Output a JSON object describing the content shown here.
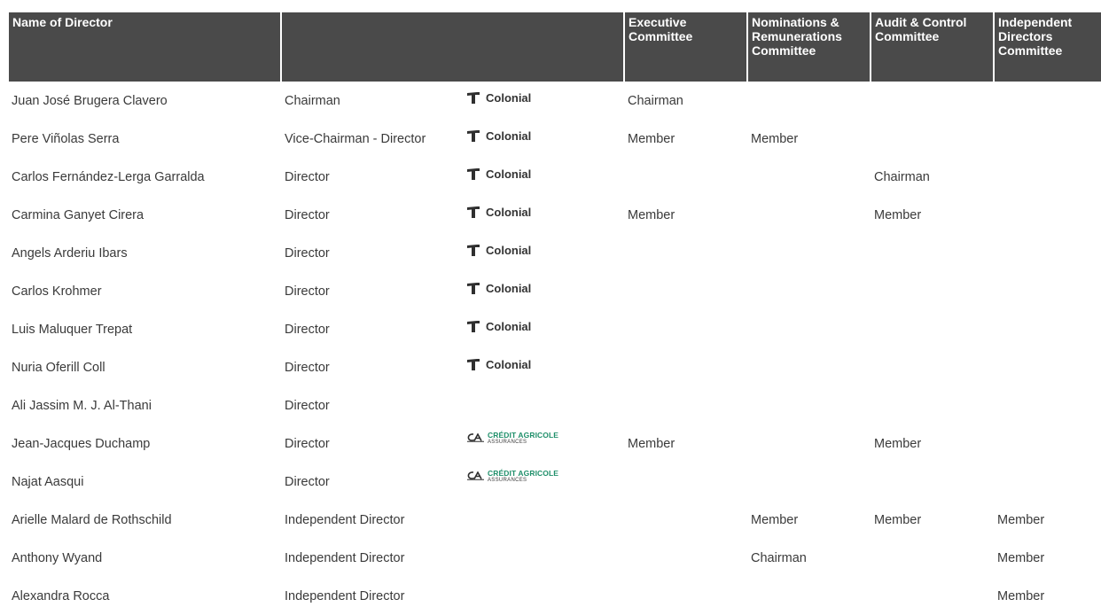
{
  "header": {
    "name_label": "Name of Director",
    "role_label": "",
    "logo_label": "",
    "executive_label": "Executive Committee",
    "nominations_label": "Nominations & Remunerations Committee",
    "audit_label": "Audit & Control Committee",
    "independent_label": "Independent Directors Committee"
  },
  "logos": {
    "colonial_text": "Colonial",
    "colonial_icon": "colonial-mark-icon",
    "ca_main": "CRÉDIT AGRICOLE",
    "ca_sub": "ASSURANCES",
    "ca_icon": "credit-agricole-logo-icon",
    "ca_color": "#1f8f6a"
  },
  "colors": {
    "header_bg": "#4a4a4a",
    "header_text": "#ffffff",
    "body_text": "#3a3a3a"
  },
  "rows": [
    {
      "name": "Juan José Brugera Clavero",
      "role": "Chairman",
      "logo": "colonial",
      "executive": "Chairman",
      "nominations": "",
      "audit": "",
      "independent": ""
    },
    {
      "name": "Pere Viñolas Serra",
      "role": "Vice-Chairman - Director",
      "logo": "colonial",
      "executive": "Member",
      "nominations": "Member",
      "audit": "",
      "independent": ""
    },
    {
      "name": "Carlos Fernández-Lerga  Garralda",
      "role": "Director",
      "logo": "colonial",
      "executive": "",
      "nominations": "",
      "audit": "Chairman",
      "independent": ""
    },
    {
      "name": "Carmina Ganyet Cirera",
      "role": "Director",
      "logo": "colonial",
      "executive": "Member",
      "nominations": "",
      "audit": "Member",
      "independent": ""
    },
    {
      "name": "Angels Arderiu Ibars",
      "role": "Director",
      "logo": "colonial",
      "executive": "",
      "nominations": "",
      "audit": "",
      "independent": ""
    },
    {
      "name": "Carlos Krohmer",
      "role": "Director",
      "logo": "colonial",
      "executive": "",
      "nominations": "",
      "audit": "",
      "independent": ""
    },
    {
      "name": "Luis Maluquer Trepat",
      "role": "Director",
      "logo": "colonial",
      "executive": "",
      "nominations": "",
      "audit": "",
      "independent": ""
    },
    {
      "name": "Nuria Oferill Coll",
      "role": "Director",
      "logo": "colonial",
      "executive": "",
      "nominations": "",
      "audit": "",
      "independent": ""
    },
    {
      "name": "Ali Jassim M. J. Al-Thani",
      "role": "Director",
      "logo": "",
      "executive": "",
      "nominations": "",
      "audit": "",
      "independent": ""
    },
    {
      "name": "Jean-Jacques Duchamp",
      "role": "Director",
      "logo": "ca",
      "executive": "Member",
      "nominations": "",
      "audit": "Member",
      "independent": ""
    },
    {
      "name": "Najat Aasqui",
      "role": "Director",
      "logo": "ca",
      "executive": "",
      "nominations": "",
      "audit": "",
      "independent": ""
    },
    {
      "name": "Arielle Malard de Rothschild",
      "role": "Independent Director",
      "logo": "",
      "executive": "",
      "nominations": "Member",
      "audit": "Member",
      "independent": "Member"
    },
    {
      "name": "Anthony Wyand",
      "role": "Independent Director",
      "logo": "",
      "executive": "",
      "nominations": "Chairman",
      "audit": "",
      "independent": "Member"
    },
    {
      "name": "Alexandra Rocca",
      "role": "Independent Director",
      "logo": "",
      "executive": "",
      "nominations": "",
      "audit": "",
      "independent": "Member"
    }
  ]
}
